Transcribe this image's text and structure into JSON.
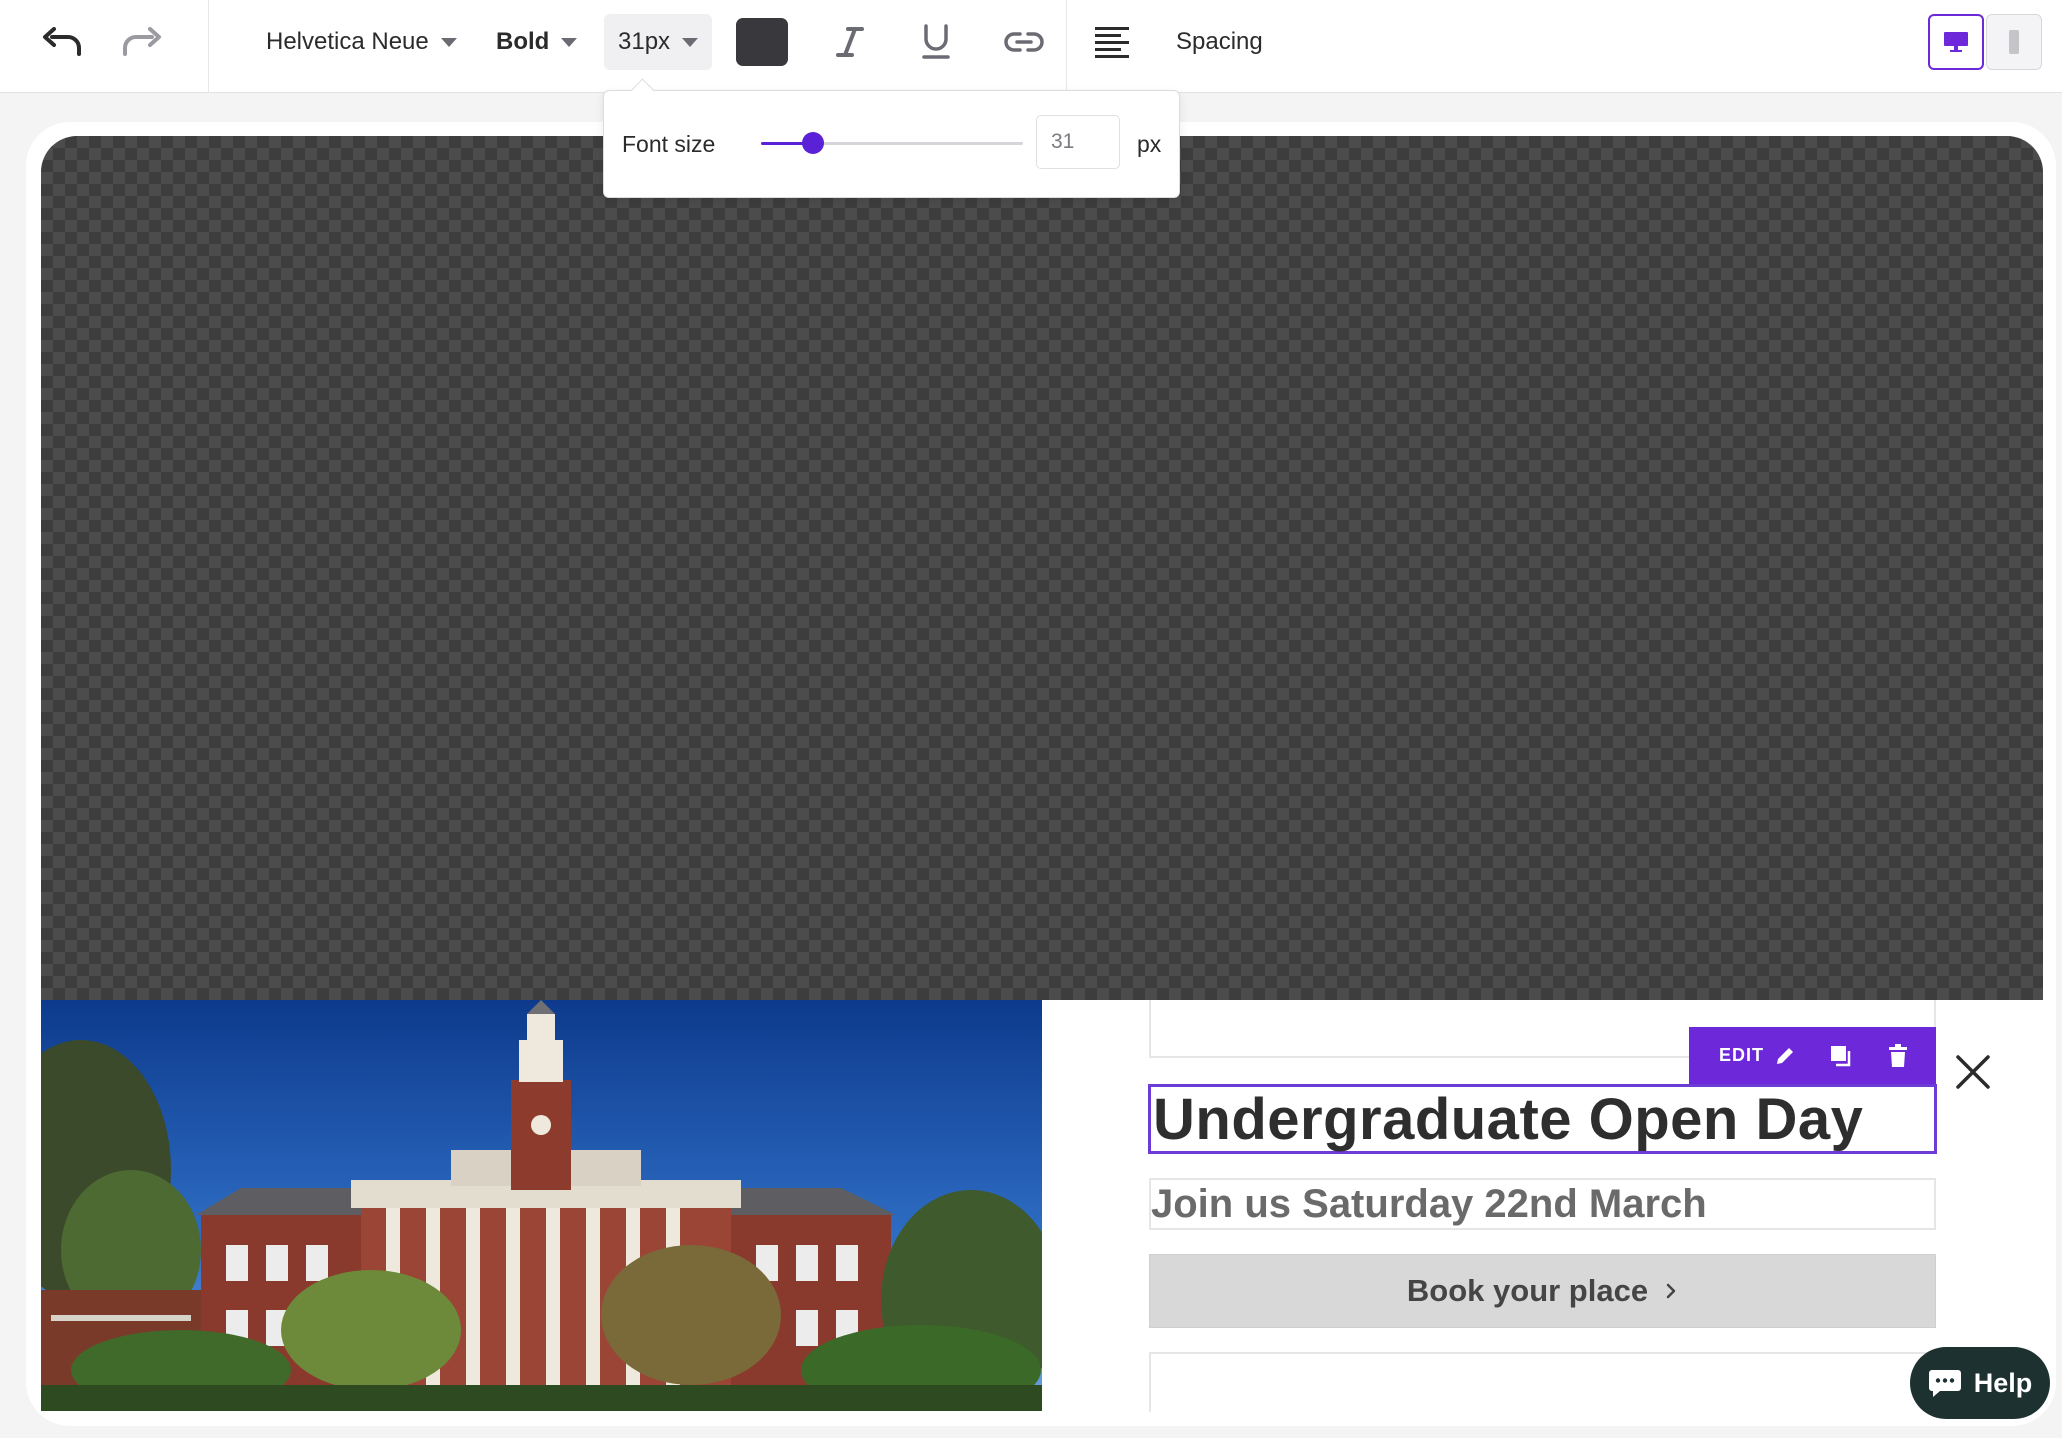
{
  "toolbar": {
    "font_family": "Helvetica Neue",
    "font_weight": "Bold",
    "font_size": "31px",
    "spacing_label": "Spacing",
    "text_color": "#38383d",
    "accent_color": "#6d28d9"
  },
  "font_size_popover": {
    "label": "Font size",
    "value": "31",
    "unit": "px",
    "slider_fraction": 0.2
  },
  "content": {
    "heading": "Undergraduate Open Day",
    "subheading": "Join us Saturday 22nd March",
    "cta_label": "Book your place"
  },
  "element_toolbar": {
    "edit_label": "EDIT"
  },
  "help": {
    "label": "Help"
  }
}
